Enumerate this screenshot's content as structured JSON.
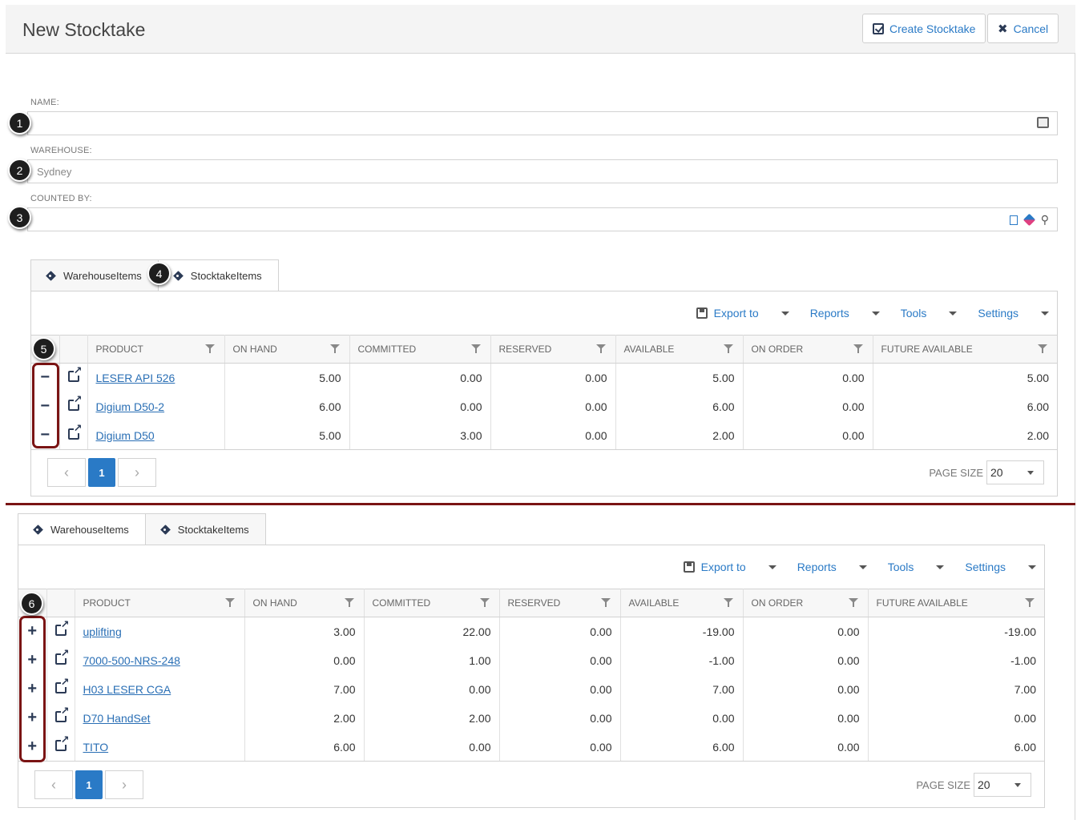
{
  "header": {
    "title": "New Stocktake",
    "create_label": "Create Stocktake",
    "cancel_label": "Cancel"
  },
  "form": {
    "name_label": "NAME:",
    "name_value": "",
    "warehouse_label": "WAREHOUSE:",
    "warehouse_value": "Sydney",
    "counted_by_label": "COUNTED BY:",
    "counted_by_value": ""
  },
  "badges": [
    "1",
    "2",
    "3",
    "4",
    "5",
    "6"
  ],
  "tabs": [
    "WarehouseItems",
    "StocktakeItems"
  ],
  "toolbar": {
    "export_label": "Export to",
    "reports_label": "Reports",
    "tools_label": "Tools",
    "settings_label": "Settings"
  },
  "columns": [
    "PRODUCT",
    "ON HAND",
    "COMMITTED",
    "RESERVED",
    "AVAILABLE",
    "ON ORDER",
    "FUTURE AVAILABLE"
  ],
  "top_grid": {
    "action_symbol": "−",
    "rows": [
      {
        "product": "LESER API 526",
        "on_hand": "5.00",
        "committed": "0.00",
        "reserved": "0.00",
        "available": "5.00",
        "on_order": "0.00",
        "future": "5.00"
      },
      {
        "product": "Digium D50-2",
        "on_hand": "6.00",
        "committed": "0.00",
        "reserved": "0.00",
        "available": "6.00",
        "on_order": "0.00",
        "future": "6.00"
      },
      {
        "product": "Digium D50",
        "on_hand": "5.00",
        "committed": "3.00",
        "reserved": "0.00",
        "available": "2.00",
        "on_order": "0.00",
        "future": "2.00"
      }
    ]
  },
  "bottom_grid": {
    "action_symbol": "+",
    "rows": [
      {
        "product": "uplifting",
        "on_hand": "3.00",
        "committed": "22.00",
        "reserved": "0.00",
        "available": "-19.00",
        "on_order": "0.00",
        "future": "-19.00"
      },
      {
        "product": "7000-500-NRS-248",
        "on_hand": "0.00",
        "committed": "1.00",
        "reserved": "0.00",
        "available": "-1.00",
        "on_order": "0.00",
        "future": "-1.00"
      },
      {
        "product": "H03 LESER CGA",
        "on_hand": "7.00",
        "committed": "0.00",
        "reserved": "0.00",
        "available": "7.00",
        "on_order": "0.00",
        "future": "7.00"
      },
      {
        "product": "D70 HandSet",
        "on_hand": "2.00",
        "committed": "2.00",
        "reserved": "0.00",
        "available": "0.00",
        "on_order": "0.00",
        "future": "0.00"
      },
      {
        "product": "TITO",
        "on_hand": "6.00",
        "committed": "0.00",
        "reserved": "0.00",
        "available": "6.00",
        "on_order": "0.00",
        "future": "6.00"
      }
    ]
  },
  "pager": {
    "prev": "‹",
    "page": "1",
    "next": "›",
    "page_size_label": "PAGE SIZE",
    "page_size_value": "20"
  },
  "colors": {
    "accent": "#2a7ac6",
    "highlight": "#7a1414",
    "icon": "#2b3a55"
  }
}
